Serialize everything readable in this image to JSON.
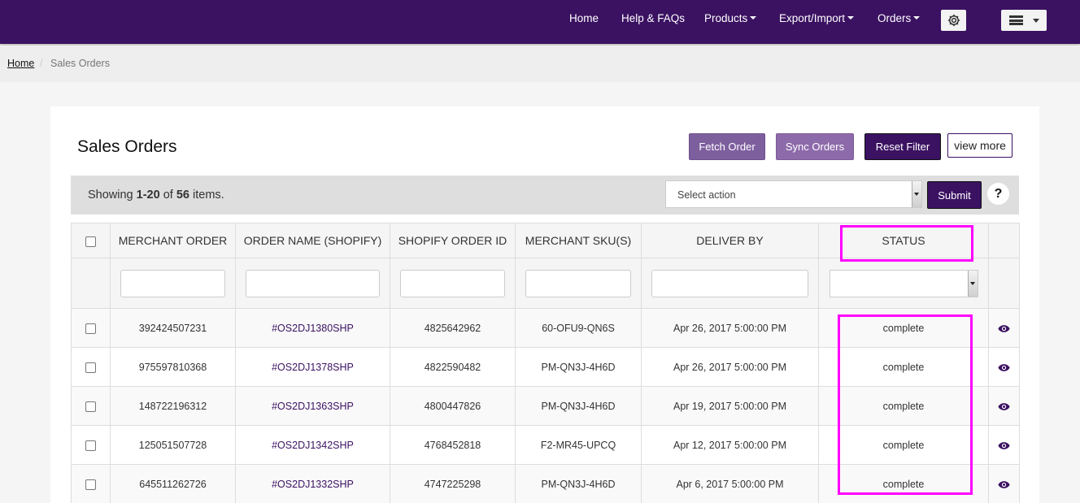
{
  "nav": {
    "items": [
      {
        "label": "Home",
        "dropdown": false
      },
      {
        "label": "Help & FAQs",
        "dropdown": false
      },
      {
        "label": "Products",
        "dropdown": true
      },
      {
        "label": "Export/Import",
        "dropdown": true
      },
      {
        "label": "Orders",
        "dropdown": true
      }
    ],
    "settings_icon": "gear-icon",
    "menu_icon": "server-stack-icon"
  },
  "breadcrumb": {
    "home": "Home",
    "separator": "/",
    "current": "Sales Orders"
  },
  "page": {
    "title": "Sales Orders",
    "buttons": {
      "fetch": "Fetch Order",
      "sync": "Sync Orders",
      "reset": "Reset Filter",
      "view_more": "view more"
    }
  },
  "toolbar": {
    "summary_prefix": "Showing ",
    "summary_range": "1-20",
    "summary_of": " of ",
    "summary_total": "56",
    "summary_suffix": " items.",
    "action_placeholder": "Select action",
    "submit": "Submit",
    "help": "?"
  },
  "table": {
    "columns": [
      "MERCHANT ORDER",
      "ORDER NAME (SHOPIFY)",
      "SHOPIFY ORDER ID",
      "MERCHANT SKU(S)",
      "DELIVER BY",
      "STATUS"
    ],
    "rows": [
      {
        "merchant_order": "392424507231",
        "order_name": "#OS2DJ1380SHP",
        "shopify_id": "4825642962",
        "sku": "60-OFU9-QN6S",
        "deliver_by": "Apr 26, 2017 5:00:00 PM",
        "status": "complete"
      },
      {
        "merchant_order": "975597810368",
        "order_name": "#OS2DJ1378SHP",
        "shopify_id": "4822590482",
        "sku": "PM-QN3J-4H6D",
        "deliver_by": "Apr 26, 2017 5:00:00 PM",
        "status": "complete"
      },
      {
        "merchant_order": "148722196312",
        "order_name": "#OS2DJ1363SHP",
        "shopify_id": "4800447826",
        "sku": "PM-QN3J-4H6D",
        "deliver_by": "Apr 19, 2017 5:00:00 PM",
        "status": "complete"
      },
      {
        "merchant_order": "125051507728",
        "order_name": "#OS2DJ1342SHP",
        "shopify_id": "4768452818",
        "sku": "F2-MR45-UPCQ",
        "deliver_by": "Apr 12, 2017 5:00:00 PM",
        "status": "complete"
      },
      {
        "merchant_order": "645511262726",
        "order_name": "#OS2DJ1332SHP",
        "shopify_id": "4747225298",
        "sku": "PM-QN3J-4H6D",
        "deliver_by": "Apr 6, 2017 5:00:00 PM",
        "status": "complete"
      }
    ],
    "row_action_icon": "eye-icon"
  },
  "highlight_color": "#ff00ff",
  "brand_color": "#3b1262"
}
